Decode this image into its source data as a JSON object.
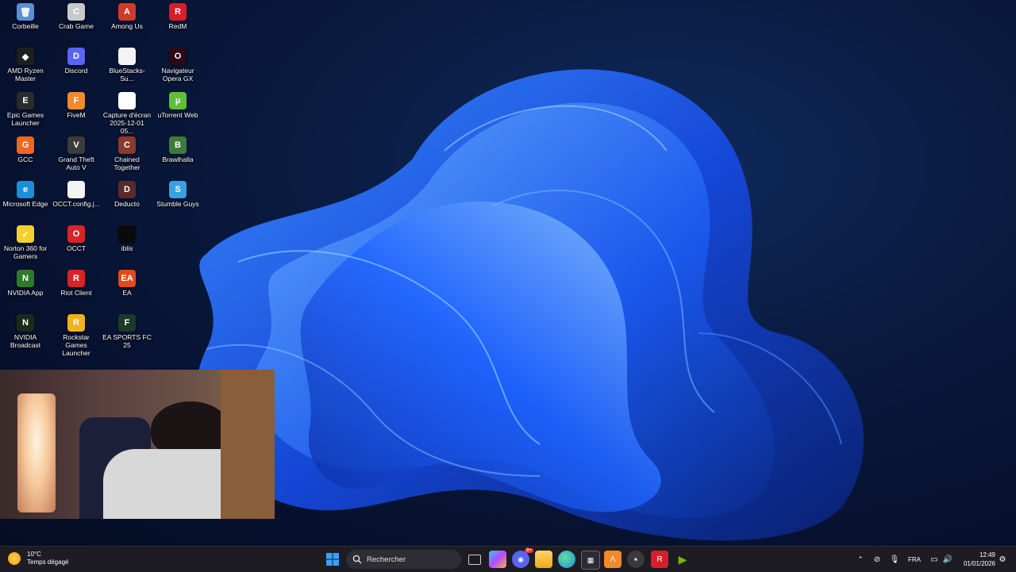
{
  "desktop": {
    "icons": [
      {
        "label": "Corbeille",
        "color": "#5b8fd8",
        "glyph": "🗑"
      },
      {
        "label": "Crab Game",
        "color": "#c9c9c9",
        "glyph": "C"
      },
      {
        "label": "Among Us",
        "color": "#d03a2b",
        "glyph": "A"
      },
      {
        "label": "RedM",
        "color": "#d81e2a",
        "glyph": "R"
      },
      {
        "label": "AMD Ryzen Master",
        "color": "#1e1e1e",
        "glyph": "◆"
      },
      {
        "label": "Discord",
        "color": "#5865f2",
        "glyph": "D"
      },
      {
        "label": "BlueStacks-Su...",
        "color": "#f4f4f4",
        "glyph": ""
      },
      {
        "label": "Navigateur Opera GX",
        "color": "#2a0a14",
        "glyph": "O"
      },
      {
        "label": "Epic Games Launcher",
        "color": "#2b2b2b",
        "glyph": "E"
      },
      {
        "label": "FiveM",
        "color": "#f08a2a",
        "glyph": "F"
      },
      {
        "label": "Capture d'écran 2025-12-01 05...",
        "color": "#ffffff",
        "glyph": ""
      },
      {
        "label": "uTorrent Web",
        "color": "#5fbf3a",
        "glyph": "µ"
      },
      {
        "label": "GCC",
        "color": "#f26522",
        "glyph": "G"
      },
      {
        "label": "Grand Theft Auto V",
        "color": "#3c3c3c",
        "glyph": "V"
      },
      {
        "label": "Chained Together",
        "color": "#8a3b2a",
        "glyph": "C"
      },
      {
        "label": "Brawlhalla",
        "color": "#3f7a3a",
        "glyph": "B"
      },
      {
        "label": "Microsoft Edge",
        "color": "#1a8fd8",
        "glyph": "e"
      },
      {
        "label": "OCCT.config.j...",
        "color": "#f4f4f4",
        "glyph": ""
      },
      {
        "label": "Deducto",
        "color": "#5a2a2a",
        "glyph": "D"
      },
      {
        "label": "Stumble Guys",
        "color": "#3aa0e0",
        "glyph": "S"
      },
      {
        "label": "Norton 360 for Gamers",
        "color": "#f2d22a",
        "glyph": "✓"
      },
      {
        "label": "OCCT",
        "color": "#d8232a",
        "glyph": "O"
      },
      {
        "label": "iblis",
        "color": "#0a0a0a",
        "glyph": ""
      },
      {
        "label": "",
        "color": "",
        "glyph": ""
      },
      {
        "label": "NVIDIA App",
        "color": "#2f7a2a",
        "glyph": "N"
      },
      {
        "label": "Riot Client",
        "color": "#d8232a",
        "glyph": "R"
      },
      {
        "label": "EA",
        "color": "#e04a1a",
        "glyph": "EA"
      },
      {
        "label": "",
        "color": "",
        "glyph": ""
      },
      {
        "label": "NVIDIA Broadcast",
        "color": "#1a2a1a",
        "glyph": "N"
      },
      {
        "label": "Rockstar Games Launcher",
        "color": "#f2b21a",
        "glyph": "R"
      },
      {
        "label": "EA SPORTS FC 25",
        "color": "#1a3a2a",
        "glyph": "F"
      }
    ]
  },
  "taskbar": {
    "weather_temp": "10°C",
    "weather_desc": "Temps dégagé",
    "search_placeholder": "Rechercher",
    "discord_badge": "9+",
    "lang": "FRA",
    "time": "12:49",
    "date": "01/01/2026"
  }
}
